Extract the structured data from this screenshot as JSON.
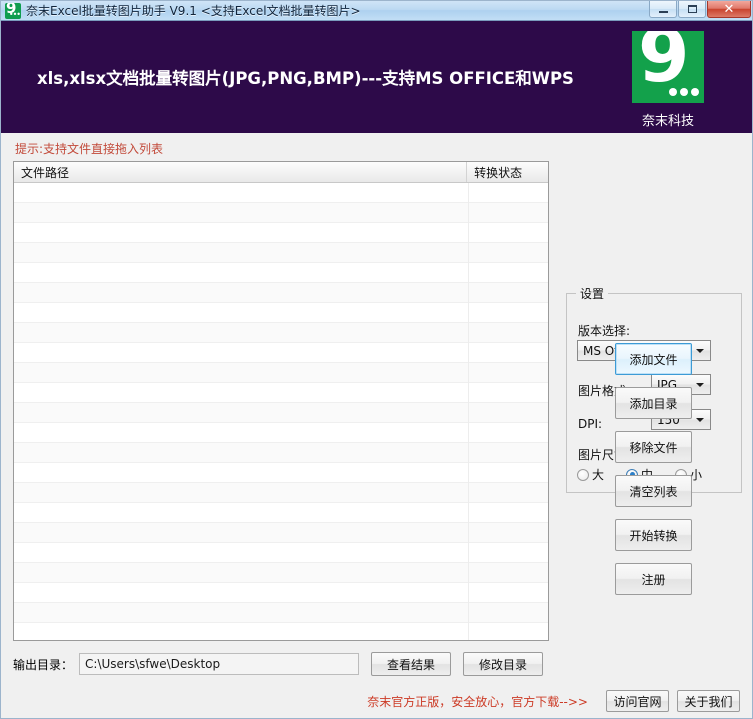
{
  "titlebar": {
    "icon": "app-logo-icon",
    "title": "奈末Excel批量转图片助手 V9.1 <支持Excel文档批量转图片>",
    "minimize": "",
    "maximize": "",
    "close": "✕"
  },
  "banner": {
    "headline": "xls,xlsx文档批量转图片(JPG,PNG,BMP)---支持MS OFFICE和WPS",
    "logo_glyph": "9",
    "logo_caption": "奈末科技",
    "logo_color": "#13a14b",
    "background_color": "#2d0a49"
  },
  "main": {
    "hint": "提示:支持文件直接拖入列表",
    "hint_color": "#c24a3a",
    "list": {
      "columns": [
        "文件路径",
        "转换状态"
      ],
      "rows": []
    },
    "output": {
      "label": "输出目录：",
      "path": "C:\\Users\\sfwe\\Desktop",
      "view_result_button": "查看结果",
      "change_dir_button": "修改目录"
    }
  },
  "settings": {
    "legend": "设置",
    "version_label": "版本选择:",
    "version_value": "MS Office",
    "format_label": "图片格式:",
    "format_value": "JPG",
    "dpi_label": "DPI:",
    "dpi_value": "150",
    "size_label": "图片尺寸:",
    "size_options": [
      {
        "label": "大",
        "checked": false
      },
      {
        "label": "中",
        "checked": true
      },
      {
        "label": "小",
        "checked": false
      }
    ]
  },
  "actions": {
    "add_file": "添加文件",
    "add_folder": "添加目录",
    "remove_file": "移除文件",
    "clear_list": "清空列表",
    "start_convert": "开始转换",
    "register": "注册"
  },
  "footer": {
    "promo_text": "奈末官方正版，安全放心，官方下载-->>",
    "promo_color": "#cc3a25",
    "visit_site_button": "访问官网",
    "about_us_button": "关于我们"
  }
}
